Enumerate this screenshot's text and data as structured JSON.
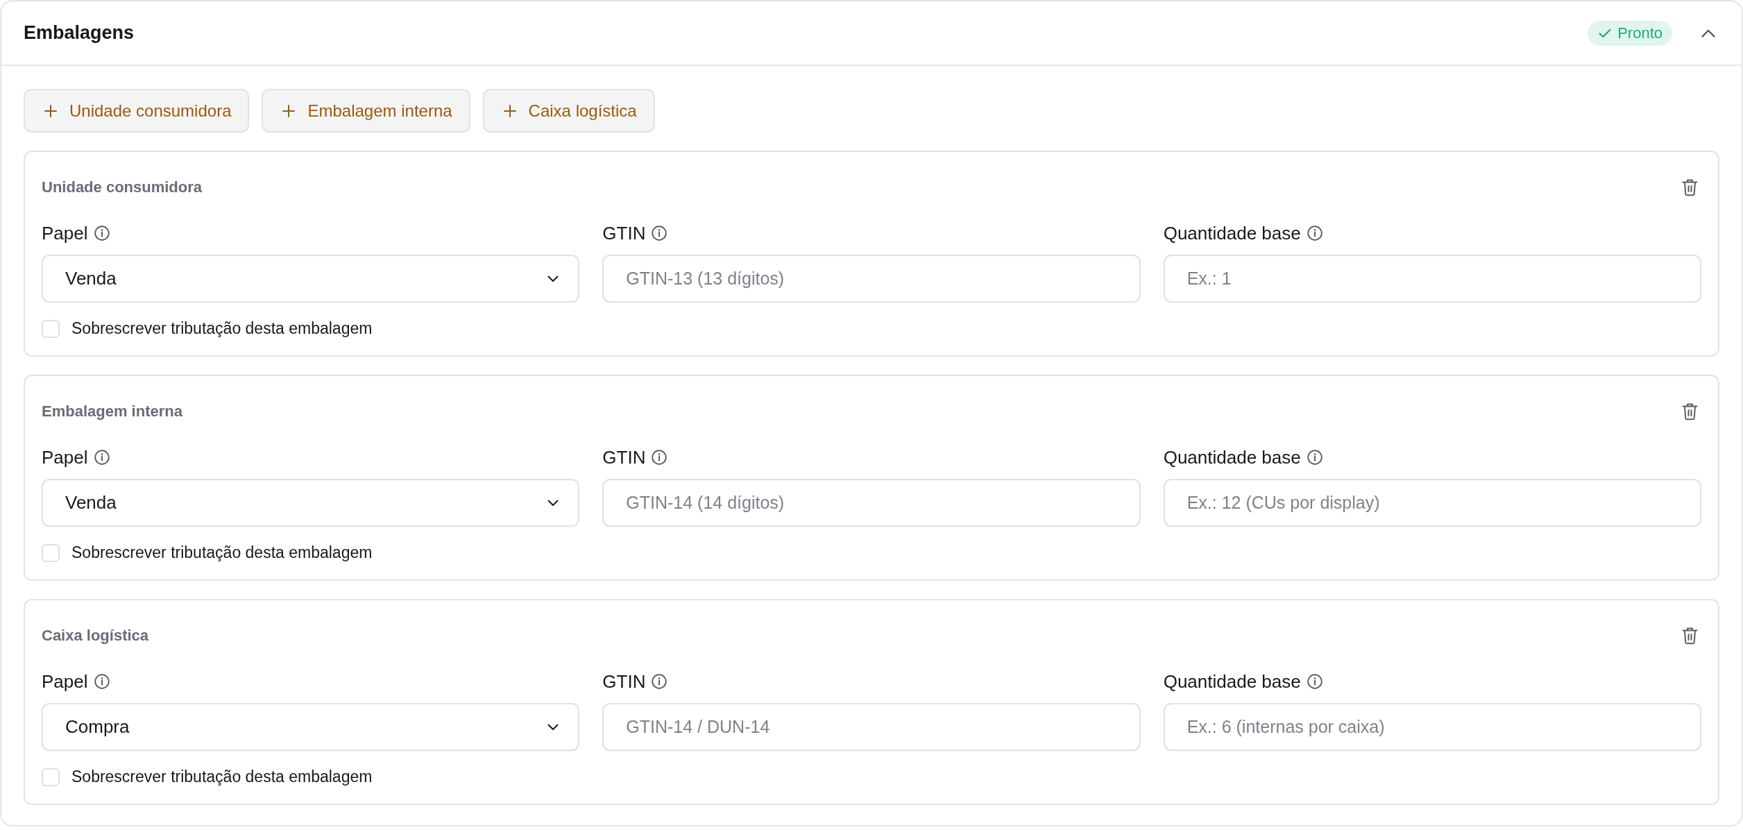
{
  "panel": {
    "title": "Embalagens",
    "status": {
      "kind": "ready",
      "label": "Pronto"
    },
    "expanded": true
  },
  "add_buttons": [
    {
      "label": "Unidade consumidora"
    },
    {
      "label": "Embalagem interna"
    },
    {
      "label": "Caixa logística"
    }
  ],
  "packages": [
    {
      "title": "Unidade consumidora",
      "fields": [
        {
          "kind": "select",
          "label": "Papel",
          "value": "Venda"
        },
        {
          "kind": "input",
          "label": "GTIN",
          "placeholder": "GTIN-13 (13 dígitos)"
        },
        {
          "kind": "input",
          "label": "Quantidade base",
          "placeholder": "Ex.: 1"
        }
      ],
      "override": {
        "label": "Sobrescrever tributação desta embalagem",
        "checked": false
      }
    },
    {
      "title": "Embalagem interna",
      "fields": [
        {
          "kind": "select",
          "label": "Papel",
          "value": "Venda"
        },
        {
          "kind": "input",
          "label": "GTIN",
          "placeholder": "GTIN-14 (14 dígitos)"
        },
        {
          "kind": "input",
          "label": "Quantidade base",
          "placeholder": "Ex.: 12 (CUs por display)"
        }
      ],
      "override": {
        "label": "Sobrescrever tributação desta embalagem",
        "checked": false
      }
    },
    {
      "title": "Caixa logística",
      "fields": [
        {
          "kind": "select",
          "label": "Papel",
          "value": "Compra"
        },
        {
          "kind": "input",
          "label": "GTIN",
          "placeholder": "GTIN-14 / DUN-14"
        },
        {
          "kind": "input",
          "label": "Quantidade base",
          "placeholder": "Ex.: 6 (internas por caixa)"
        }
      ],
      "override": {
        "label": "Sobrescrever tributação desta embalagem",
        "checked": false
      }
    }
  ]
}
